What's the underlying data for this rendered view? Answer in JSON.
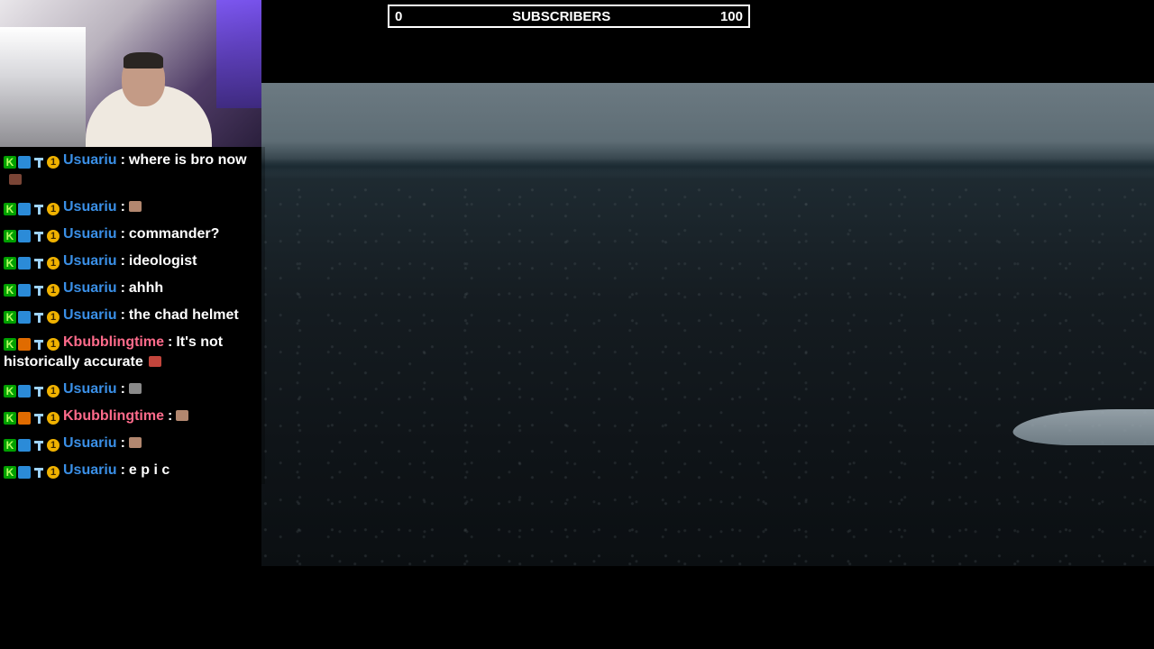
{
  "subscribers_bar": {
    "left_value": "0",
    "label": "SUBSCRIBERS",
    "right_value": "100",
    "progress_fraction": 0.0,
    "fill_color": "#ffffff"
  },
  "chat": {
    "messages": [
      {
        "user": "Usuariu",
        "text": "where is bro now",
        "user_color": "#3a8fe6",
        "emote": "emote-brown"
      },
      {
        "user": "Usuariu",
        "text": "",
        "user_color": "#3a8fe6",
        "emote": "emote-face"
      },
      {
        "user": "Usuariu",
        "text": "commander?",
        "user_color": "#3a8fe6"
      },
      {
        "user": "Usuariu",
        "text": "ideologist",
        "user_color": "#3a8fe6"
      },
      {
        "user": "Usuariu",
        "text": "ahhh",
        "user_color": "#3a8fe6"
      },
      {
        "user": "Usuariu",
        "text": "the chad helmet",
        "user_color": "#3a8fe6"
      },
      {
        "user": "Kbubblingtime",
        "text": "It's not historically accurate",
        "user_color": "#ff6b8b",
        "emote": "emote-red"
      },
      {
        "user": "Usuariu",
        "text": "",
        "user_color": "#3a8fe6",
        "emote": "emote-grey"
      },
      {
        "user": "Kbubblingtime",
        "text": "",
        "user_color": "#ff6b8b",
        "emote": "emote-face"
      },
      {
        "user": "Usuariu",
        "text": "",
        "user_color": "#3a8fe6",
        "emote": "emote-lips"
      },
      {
        "user": "Usuariu",
        "text": "e p i c",
        "user_color": "#3a8fe6"
      }
    ]
  },
  "icons": {
    "badge_1": "k-badge-icon",
    "badge_2": "pickaxe-badge-icon",
    "badge_2_alt": "cube-badge-icon",
    "badge_3": "hammer-badge-icon",
    "badge_4": "coin-badge-icon"
  }
}
